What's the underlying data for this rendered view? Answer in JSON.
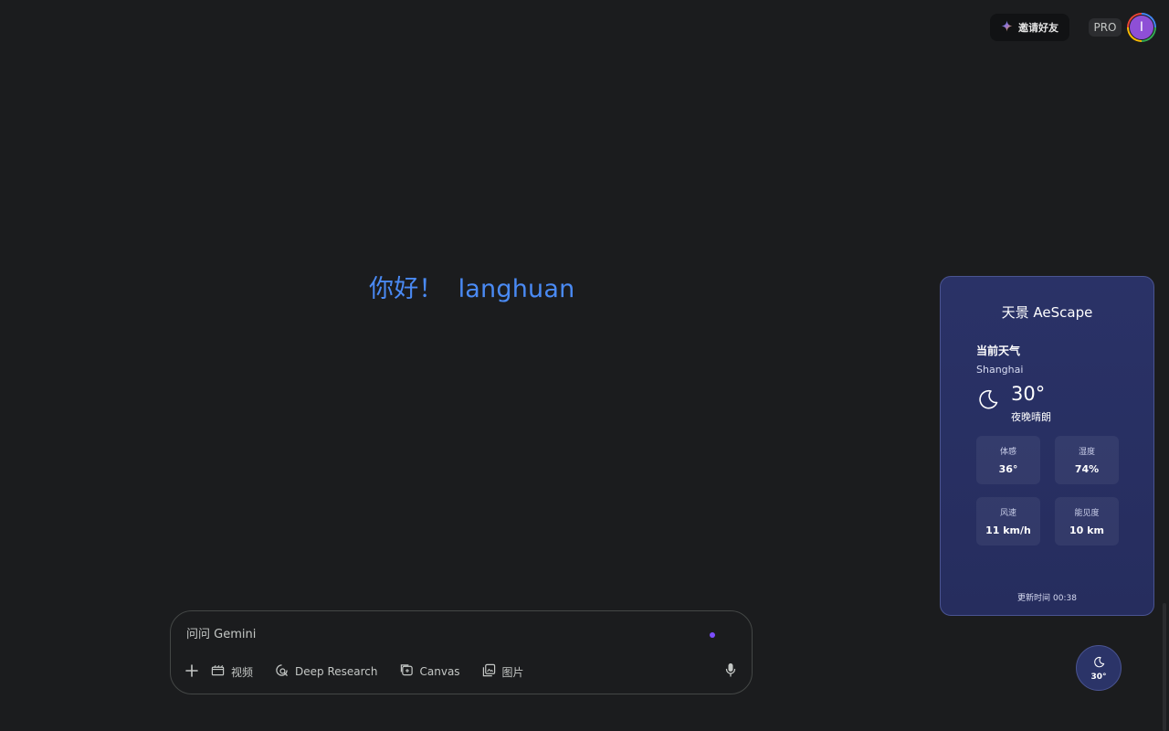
{
  "header": {
    "invite_label": "邀请好友",
    "pro_label": "PRO",
    "avatar_initial": "I"
  },
  "greeting": {
    "hello": "你好！",
    "name": "langhuan"
  },
  "prompt": {
    "placeholder": "问问 Gemini",
    "tools": {
      "video": "视频",
      "deep_research": "Deep Research",
      "canvas": "Canvas",
      "image": "图片"
    }
  },
  "weather": {
    "title": "天景 AeScape",
    "section_label": "当前天气",
    "city": "Shanghai",
    "temperature": "30°",
    "condition": "夜晚晴朗",
    "stats": {
      "feels_like": {
        "label": "体感",
        "value": "36°"
      },
      "humidity": {
        "label": "湿度",
        "value": "74%"
      },
      "wind": {
        "label": "风速",
        "value": "11 km/h"
      },
      "visibility": {
        "label": "能见度",
        "value": "10 km"
      }
    },
    "updated_label": "更新时间",
    "updated_time": "00:38",
    "fab_temperature": "30°"
  },
  "colors": {
    "background": "#1b1c1e",
    "greeting_blue": "#4a8af4",
    "weather_card": "#2a3267",
    "prompt_dot": "#7c4dff",
    "avatar": "#8e4fd6"
  },
  "icons": {
    "invite": "sparkle-icon",
    "add": "plus-icon",
    "video": "clapperboard-icon",
    "deep_research": "research-icon",
    "canvas": "canvas-icon",
    "image": "image-stack-icon",
    "mic": "microphone-icon",
    "weather": "moon-icon"
  }
}
